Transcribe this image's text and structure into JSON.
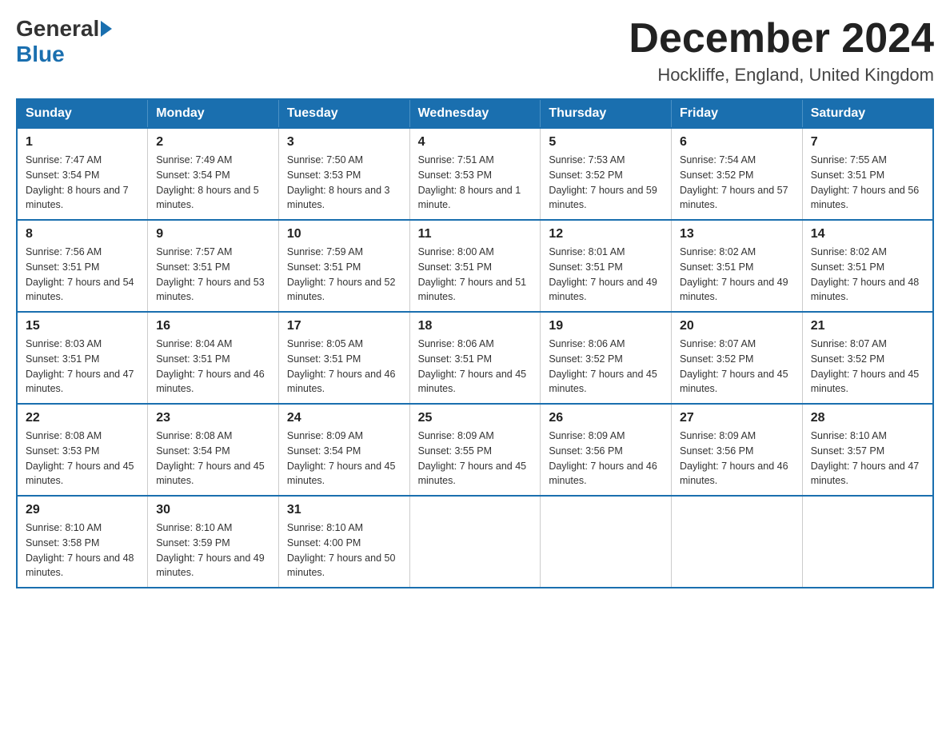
{
  "header": {
    "logo_general": "General",
    "logo_blue": "Blue",
    "month_title": "December 2024",
    "location": "Hockliffe, England, United Kingdom"
  },
  "days_of_week": [
    "Sunday",
    "Monday",
    "Tuesday",
    "Wednesday",
    "Thursday",
    "Friday",
    "Saturday"
  ],
  "weeks": [
    [
      {
        "day": "1",
        "sunrise": "7:47 AM",
        "sunset": "3:54 PM",
        "daylight": "8 hours and 7 minutes."
      },
      {
        "day": "2",
        "sunrise": "7:49 AM",
        "sunset": "3:54 PM",
        "daylight": "8 hours and 5 minutes."
      },
      {
        "day": "3",
        "sunrise": "7:50 AM",
        "sunset": "3:53 PM",
        "daylight": "8 hours and 3 minutes."
      },
      {
        "day": "4",
        "sunrise": "7:51 AM",
        "sunset": "3:53 PM",
        "daylight": "8 hours and 1 minute."
      },
      {
        "day": "5",
        "sunrise": "7:53 AM",
        "sunset": "3:52 PM",
        "daylight": "7 hours and 59 minutes."
      },
      {
        "day": "6",
        "sunrise": "7:54 AM",
        "sunset": "3:52 PM",
        "daylight": "7 hours and 57 minutes."
      },
      {
        "day": "7",
        "sunrise": "7:55 AM",
        "sunset": "3:51 PM",
        "daylight": "7 hours and 56 minutes."
      }
    ],
    [
      {
        "day": "8",
        "sunrise": "7:56 AM",
        "sunset": "3:51 PM",
        "daylight": "7 hours and 54 minutes."
      },
      {
        "day": "9",
        "sunrise": "7:57 AM",
        "sunset": "3:51 PM",
        "daylight": "7 hours and 53 minutes."
      },
      {
        "day": "10",
        "sunrise": "7:59 AM",
        "sunset": "3:51 PM",
        "daylight": "7 hours and 52 minutes."
      },
      {
        "day": "11",
        "sunrise": "8:00 AM",
        "sunset": "3:51 PM",
        "daylight": "7 hours and 51 minutes."
      },
      {
        "day": "12",
        "sunrise": "8:01 AM",
        "sunset": "3:51 PM",
        "daylight": "7 hours and 49 minutes."
      },
      {
        "day": "13",
        "sunrise": "8:02 AM",
        "sunset": "3:51 PM",
        "daylight": "7 hours and 49 minutes."
      },
      {
        "day": "14",
        "sunrise": "8:02 AM",
        "sunset": "3:51 PM",
        "daylight": "7 hours and 48 minutes."
      }
    ],
    [
      {
        "day": "15",
        "sunrise": "8:03 AM",
        "sunset": "3:51 PM",
        "daylight": "7 hours and 47 minutes."
      },
      {
        "day": "16",
        "sunrise": "8:04 AM",
        "sunset": "3:51 PM",
        "daylight": "7 hours and 46 minutes."
      },
      {
        "day": "17",
        "sunrise": "8:05 AM",
        "sunset": "3:51 PM",
        "daylight": "7 hours and 46 minutes."
      },
      {
        "day": "18",
        "sunrise": "8:06 AM",
        "sunset": "3:51 PM",
        "daylight": "7 hours and 45 minutes."
      },
      {
        "day": "19",
        "sunrise": "8:06 AM",
        "sunset": "3:52 PM",
        "daylight": "7 hours and 45 minutes."
      },
      {
        "day": "20",
        "sunrise": "8:07 AM",
        "sunset": "3:52 PM",
        "daylight": "7 hours and 45 minutes."
      },
      {
        "day": "21",
        "sunrise": "8:07 AM",
        "sunset": "3:52 PM",
        "daylight": "7 hours and 45 minutes."
      }
    ],
    [
      {
        "day": "22",
        "sunrise": "8:08 AM",
        "sunset": "3:53 PM",
        "daylight": "7 hours and 45 minutes."
      },
      {
        "day": "23",
        "sunrise": "8:08 AM",
        "sunset": "3:54 PM",
        "daylight": "7 hours and 45 minutes."
      },
      {
        "day": "24",
        "sunrise": "8:09 AM",
        "sunset": "3:54 PM",
        "daylight": "7 hours and 45 minutes."
      },
      {
        "day": "25",
        "sunrise": "8:09 AM",
        "sunset": "3:55 PM",
        "daylight": "7 hours and 45 minutes."
      },
      {
        "day": "26",
        "sunrise": "8:09 AM",
        "sunset": "3:56 PM",
        "daylight": "7 hours and 46 minutes."
      },
      {
        "day": "27",
        "sunrise": "8:09 AM",
        "sunset": "3:56 PM",
        "daylight": "7 hours and 46 minutes."
      },
      {
        "day": "28",
        "sunrise": "8:10 AM",
        "sunset": "3:57 PM",
        "daylight": "7 hours and 47 minutes."
      }
    ],
    [
      {
        "day": "29",
        "sunrise": "8:10 AM",
        "sunset": "3:58 PM",
        "daylight": "7 hours and 48 minutes."
      },
      {
        "day": "30",
        "sunrise": "8:10 AM",
        "sunset": "3:59 PM",
        "daylight": "7 hours and 49 minutes."
      },
      {
        "day": "31",
        "sunrise": "8:10 AM",
        "sunset": "4:00 PM",
        "daylight": "7 hours and 50 minutes."
      },
      null,
      null,
      null,
      null
    ]
  ],
  "labels": {
    "sunrise": "Sunrise:",
    "sunset": "Sunset:",
    "daylight": "Daylight:"
  }
}
